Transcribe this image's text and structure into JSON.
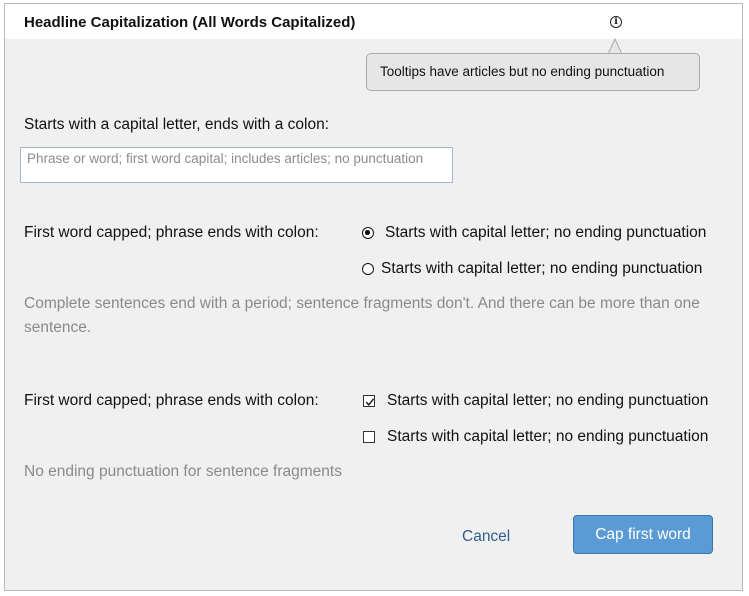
{
  "dialog": {
    "title": "Headline Capitalization (All Words Capitalized)",
    "info_icon": "info-icon",
    "tooltip": "Tooltips have articles but no ending punctuation"
  },
  "text_field": {
    "label": "Starts with a capital letter, ends with a colon:",
    "placeholder": "Phrase or word; first word capital; includes articles; no punctuation",
    "value": ""
  },
  "radio_group": {
    "label": "First word capped; phrase ends with colon:",
    "options": [
      {
        "label": "Starts with capital letter; no ending punctuation",
        "selected": true
      },
      {
        "label": "Starts with capital letter; no ending punctuation",
        "selected": false
      }
    ],
    "helper": "Complete sentences end with a period; sentence fragments don't. And there can be more than one sentence."
  },
  "checkbox_group": {
    "label": "First word capped; phrase ends with colon:",
    "options": [
      {
        "label": "Starts with capital letter; no ending punctuation",
        "checked": true
      },
      {
        "label": "Starts with capital letter; no ending punctuation",
        "checked": false
      }
    ],
    "helper": "No ending punctuation for sentence fragments"
  },
  "buttons": {
    "cancel": "Cancel",
    "primary": "Cap first word"
  },
  "colors": {
    "primary_button": "#5b9bd5",
    "link": "#2e5d8c",
    "background": "#f0f0f0",
    "helper_text": "#8a8a8a"
  }
}
